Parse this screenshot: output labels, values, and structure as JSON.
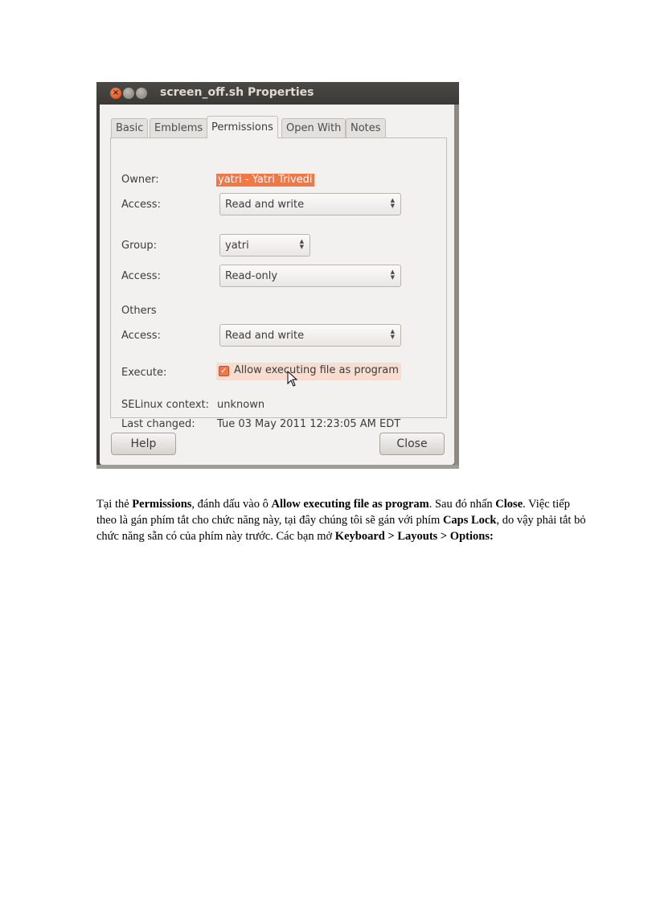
{
  "window": {
    "title": "screen_off.sh Properties",
    "close_glyph": "×"
  },
  "tabs": [
    {
      "label": "Basic",
      "active": false
    },
    {
      "label": "Emblems",
      "active": false
    },
    {
      "label": "Permissions",
      "active": true
    },
    {
      "label": "Open With",
      "active": false
    },
    {
      "label": "Notes",
      "active": false
    }
  ],
  "permissions": {
    "owner_label": "Owner:",
    "owner_value": "yatri - Yatri Trivedi",
    "owner_access_label": "Access:",
    "owner_access_value": "Read and write",
    "group_label": "Group:",
    "group_value": "yatri",
    "group_access_label": "Access:",
    "group_access_value": "Read-only",
    "others_label": "Others",
    "others_access_label": "Access:",
    "others_access_value": "Read and write",
    "execute_label": "Execute:",
    "execute_checkbox_label": "Allow executing file as program",
    "execute_checked": true,
    "selinux_label": "SELinux context:",
    "selinux_value": "unknown",
    "last_changed_label": "Last changed:",
    "last_changed_value": "Tue 03 May 2011 12:23:05 AM EDT"
  },
  "buttons": {
    "help": "Help",
    "close": "Close"
  },
  "paragraph": [
    {
      "text": "Tại thẻ ",
      "bold": false
    },
    {
      "text": "Permissions",
      "bold": true
    },
    {
      "text": ", đánh dấu vào ô ",
      "bold": false
    },
    {
      "text": "Allow executing file as program",
      "bold": true
    },
    {
      "text": ". Sau đó nhấn ",
      "bold": false
    },
    {
      "text": "Close",
      "bold": true
    },
    {
      "text": ". Việc tiếp theo là gán phím tắt cho chức năng này, tại đây chúng tôi sẽ gán với phím ",
      "bold": false
    },
    {
      "text": "Caps Lock",
      "bold": true
    },
    {
      "text": ", do vậy phải tắt bỏ chức năng sẵn có của phím này trước. Các bạn mở ",
      "bold": false
    },
    {
      "text": "Keyboard > Layouts > Options:",
      "bold": true
    }
  ],
  "colors": {
    "accent": "#f07746",
    "titlebar": "#3c3b37",
    "dialog_bg": "#f2f1f0"
  }
}
